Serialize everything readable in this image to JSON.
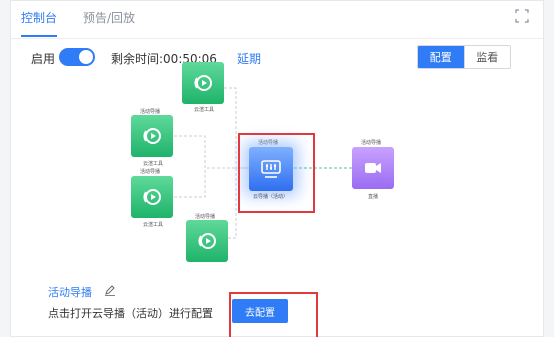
{
  "tabs": {
    "console": "控制台",
    "preview": "预告/回放"
  },
  "controls": {
    "enable_label": "启用",
    "enabled": true,
    "remaining_label": "剩余时间:",
    "remaining_time": "00:50:06",
    "extend": "延期"
  },
  "view_switch": {
    "config": "配置",
    "watch": "监看",
    "selected": "config"
  },
  "diagram": {
    "top_source": {
      "caption": "云渲工具"
    },
    "src1": {
      "top_label": "活动导播",
      "caption": "云渲工具"
    },
    "src2": {
      "top_label": "活动导播",
      "caption": "云渲工具"
    },
    "src3": {
      "top_label": "活动导播"
    },
    "guide": {
      "top_label": "活动导播",
      "caption": "云导播（活动）"
    },
    "live": {
      "top_label": "活动导播",
      "caption": "直播"
    }
  },
  "bottom": {
    "guide_name": "活动导播",
    "hint": "点击打开云导播（活动）进行配置",
    "go_config": "去配置"
  },
  "colors": {
    "accent": "#2f7cf6",
    "source_green": "#1fb36a",
    "guide_blue": "#2f6ff0",
    "live_purple": "#9a6cf2",
    "highlight_red": "#e0393e"
  }
}
